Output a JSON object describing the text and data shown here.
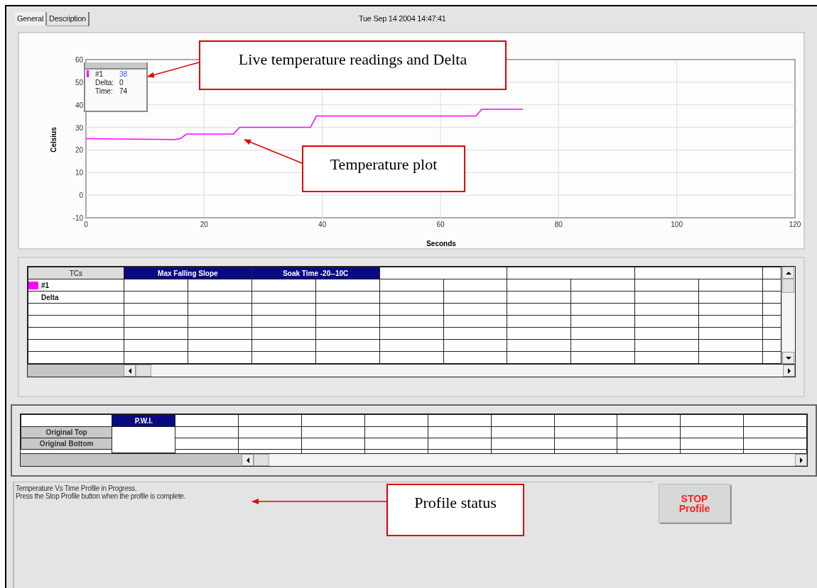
{
  "tabs": [
    {
      "label": "General",
      "selected": true
    },
    {
      "label": "Description",
      "selected": false
    }
  ],
  "timestamp": "Tue Sep 14 2004 14:47:41",
  "chart": {
    "legend": {
      "reading": "38",
      "delta_label": "Delta:",
      "delta": "0",
      "time_label": "Time:",
      "time": "74"
    },
    "chart_data": {
      "type": "line",
      "grid": true,
      "xlabel": "Seconds",
      "ylabel": "Celsius",
      "xlim": [
        0,
        120
      ],
      "ylim": [
        -10,
        60
      ],
      "xticks": [
        0,
        20,
        40,
        60,
        80,
        100,
        120
      ],
      "yticks": [
        -10,
        0,
        10,
        20,
        30,
        40,
        50,
        60
      ],
      "x": [
        0,
        15,
        16,
        17,
        25,
        26,
        38,
        39,
        66,
        67,
        74
      ],
      "series": [
        {
          "name": "#1",
          "color": "#ff00ff",
          "values": [
            25,
            24.6,
            25,
            27,
            27,
            30,
            30,
            35,
            35,
            38,
            38
          ]
        }
      ]
    }
  },
  "tc_table": {
    "columns": [
      {
        "label": "TCs",
        "selected": false
      },
      {
        "label": "Max Falling Slope",
        "selected": true
      },
      {
        "label": "Soak Time -20--10C",
        "selected": true
      }
    ],
    "rows": [
      {
        "label": "#1",
        "color": "#ff00ff"
      },
      {
        "label": "Delta"
      }
    ]
  },
  "pwi_table": {
    "columns": [
      {
        "label": "P.W.I.",
        "selected": true
      }
    ],
    "rows": [
      {
        "label": "Original Top"
      },
      {
        "label": "Original Bottom"
      }
    ]
  },
  "status": {
    "lines": [
      "Temperature Vs Time Profile in Progress.",
      "Press the Stop Profile button when the profile is complete."
    ]
  },
  "stop_button": {
    "lines": [
      "STOP",
      "Profile"
    ]
  },
  "annotations": [
    {
      "text": "Live temperature readings and Delta"
    },
    {
      "text": "Temperature plot"
    },
    {
      "text": "Profile status"
    }
  ]
}
